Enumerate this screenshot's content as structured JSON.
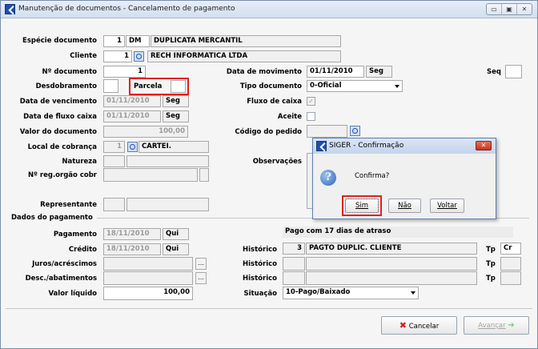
{
  "window": {
    "title": "Manutenção de documentos - Cancelamento de pagamento",
    "controls": [
      "▭",
      "▣",
      "✕"
    ]
  },
  "form": {
    "especie_label": "Espécie documento",
    "especie_code": "1",
    "especie_sigla": "DM",
    "especie_desc": "DUPLICATA MERCANTIL",
    "cliente_label": "Cliente",
    "cliente_code": "1",
    "cliente_nome": "RECH INFORMATICA LTDA",
    "ndoc_label": "Nº documento",
    "ndoc_value": "1",
    "data_mov_label": "Data de movimento",
    "data_mov_value": "01/11/2010",
    "data_mov_dia": "Seg",
    "seq_label": "Seq",
    "seq_value": "",
    "desdobramento_label": "Desdobramento",
    "desdobramento_value": "",
    "parcela_label": "Parcela",
    "parcela_value": "",
    "tipo_doc_label": "Tipo documento",
    "tipo_doc_value": "0-Oficial",
    "venc_label": "Data de vencimento",
    "venc_value": "01/11/2010",
    "venc_dia": "Seg",
    "fluxo_caixa_label": "Fluxo de caixa",
    "data_fluxo_label": "Data de fluxo caixa",
    "data_fluxo_value": "01/11/2010",
    "data_fluxo_dia": "Seg",
    "aceite_label": "Aceite",
    "valor_doc_label": "Valor do documento",
    "valor_doc_value": "100,00",
    "cod_pedido_label": "Código do pedido",
    "cod_pedido_value": "",
    "local_label": "Local de cobrança",
    "local_code": "1",
    "local_desc": "CARTEI.",
    "natureza_label": "Natureza",
    "observacoes_label": "Observações",
    "reg_orgao_label": "Nº reg.orgão cobr",
    "representante_label": "Representante"
  },
  "pagamento": {
    "section_title": "Dados do pagamento",
    "pagamento_label": "Pagamento",
    "pagamento_value": "18/11/2010",
    "pagamento_dia": "Qui",
    "atraso_text": "Pago com 17 dias de atraso",
    "credito_label": "Crédito",
    "credito_value": "18/11/2010",
    "credito_dia": "Qui",
    "historico_label": "Histórico",
    "historico1_code": "3",
    "historico1_desc": "PAGTO DUPLIC. CLIENTE",
    "tp_label": "Tp",
    "tp1_value": "Cr",
    "juros_label": "Juros/acréscimos",
    "desc_label": "Desc./abatimentos",
    "valor_liq_label": "Valor líquido",
    "valor_liq_value": "100,00",
    "situacao_label": "Situação",
    "situacao_value": "10-Pago/Baixado",
    "ellipsis": "..."
  },
  "footer": {
    "cancelar_label": "Cancelar",
    "avancar_label": "Avançar"
  },
  "dialog": {
    "title": "SIGER - Confirmação",
    "message": "Confirma?",
    "close": "✕",
    "sim_label": "Sim",
    "nao_label": "Não",
    "voltar_label": "Voltar"
  },
  "colors": {
    "accent": "#1f4fa8",
    "highlight": "#e02020"
  }
}
